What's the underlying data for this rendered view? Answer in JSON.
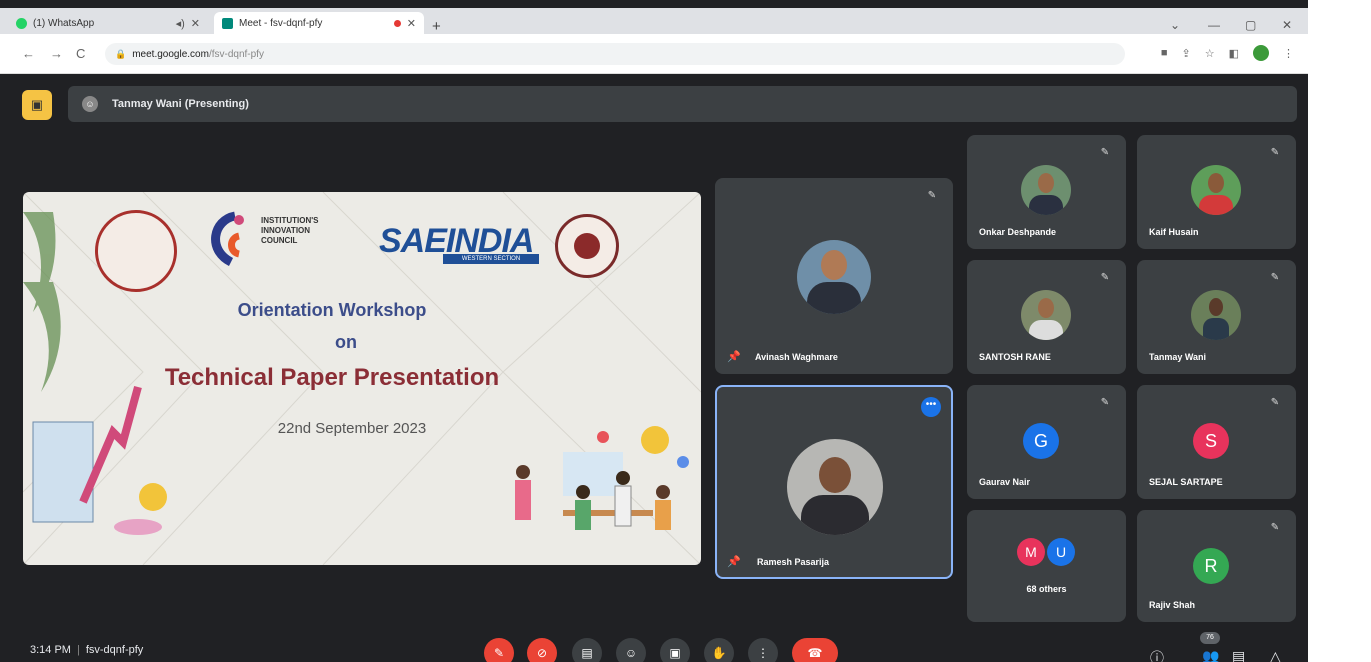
{
  "browser": {
    "tabs": [
      {
        "label": "(1) WhatsApp",
        "active": false
      },
      {
        "label": "Meet - fsv-dqnf-pfy",
        "active": true
      }
    ],
    "url_host": "meet.google.com",
    "url_path": "/fsv-dqnf-pfy"
  },
  "meet": {
    "presenting_label": "Tanmay Wani (Presenting)",
    "meeting_code": "fsv-dqnf-pfy",
    "time": "3:14 PM",
    "participant_count": "76"
  },
  "slide": {
    "iic_lines": [
      "INSTITUTION'S",
      "INNOVATION",
      "COUNCIL"
    ],
    "sae_logo": "SAEINDIA",
    "sae_subtitle": "WESTERN SECTION",
    "line1": "Orientation Workshop",
    "line2": "on",
    "line3": "Technical Paper Presentation",
    "date": "22nd September 2023"
  },
  "participants": {
    "pinned": [
      {
        "name": "Avinash Waghmare"
      },
      {
        "name": "Ramesh Pasarija"
      }
    ],
    "grid": [
      {
        "name": "Onkar Deshpande",
        "avatar": "photo"
      },
      {
        "name": "Kaif Husain",
        "avatar": "photo"
      },
      {
        "name": "SANTOSH RANE",
        "avatar": "photo"
      },
      {
        "name": "Tanmay Wani",
        "avatar": "photo"
      },
      {
        "name": "Gaurav Nair",
        "initial": "G",
        "color": "#1a73e8"
      },
      {
        "name": "SEJAL SARTAPE",
        "initial": "S",
        "color": "#e8335c"
      },
      {
        "name": "68 others",
        "initials": [
          "M",
          "U"
        ],
        "colors": [
          "#e8335c",
          "#1a73e8"
        ]
      },
      {
        "name": "Rajiv Shah",
        "initial": "R",
        "color": "#34a853"
      }
    ]
  },
  "colors": {
    "meet_bg": "#202124",
    "tile_bg": "#3c4043",
    "end_call": "#ea4335",
    "present_accent": "#f5c344"
  }
}
